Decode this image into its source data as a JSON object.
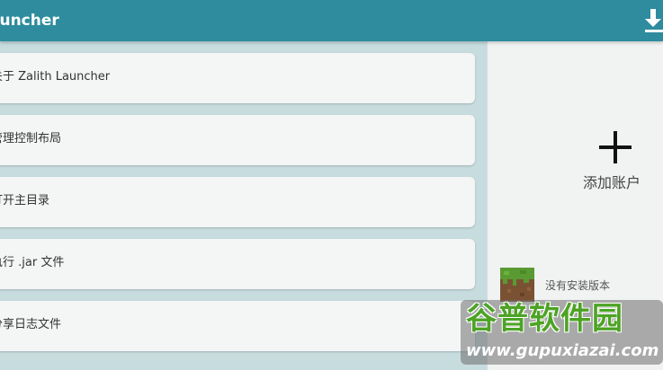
{
  "header": {
    "title": "auncher",
    "download_icon": "download-icon"
  },
  "menu": {
    "items": [
      {
        "label": "关于 Zalith Launcher"
      },
      {
        "label": "管理控制布局"
      },
      {
        "label": "打开主目录"
      },
      {
        "label": "执行 .jar 文件"
      },
      {
        "label": "分享日志文件"
      }
    ]
  },
  "account": {
    "add_label": "添加账户",
    "icon": "plus-icon"
  },
  "version": {
    "label": "没有安装版本",
    "icon": "grass-block-icon"
  },
  "watermark": {
    "title": "谷普软件园",
    "url": "www.gupuxiazai.com"
  },
  "colors": {
    "accent": "#2e8c9e",
    "background": "#c7dcde",
    "card": "#f4f5f5",
    "side_panel": "#f1f2f2"
  }
}
